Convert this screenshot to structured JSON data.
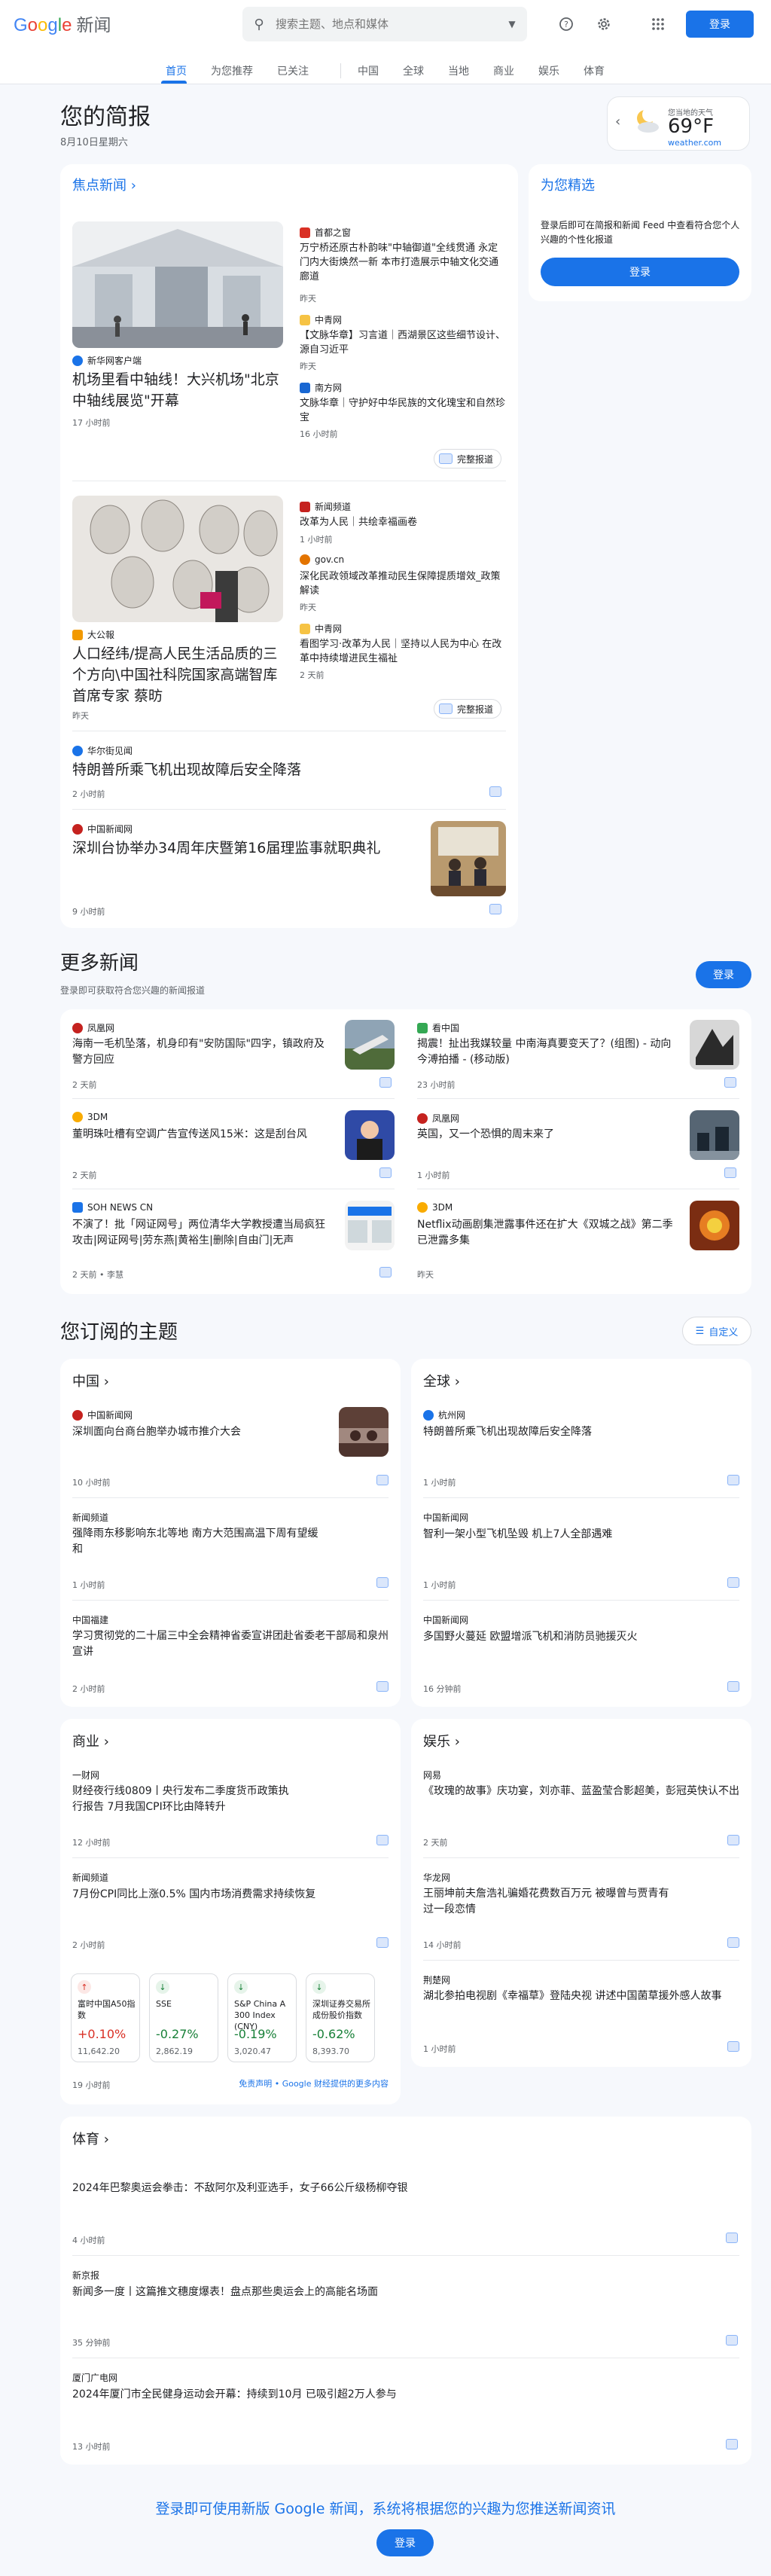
{
  "header": {
    "logo_google": "Google",
    "logo_news": "新闻",
    "search_placeholder": "搜索主题、地点和媒体",
    "login": "登录"
  },
  "nav": {
    "tabs": [
      "首页",
      "为您推荐",
      "已关注",
      "中国",
      "全球",
      "当地",
      "商业",
      "娱乐",
      "体育"
    ],
    "active": "首页"
  },
  "briefing": {
    "title": "您的简报",
    "date": "8月10日星期六"
  },
  "weather": {
    "label": "您当地的天气",
    "temp": "69°F",
    "source": "weather.com"
  },
  "picks": {
    "title": "为您精选",
    "desc": "登录后即可在简报和新闻 Feed 中查看符合您个人兴趣的个性化报道",
    "login": "登录"
  },
  "top": {
    "title": "焦点新闻",
    "full_coverage": "完整报道",
    "c1": {
      "main": {
        "source": "新华网客户端",
        "headline": "机场里看中轴线！大兴机场\"北京中轴线展览\"开幕",
        "time": "17 小时前"
      },
      "side": [
        {
          "source": "首都之窗",
          "headline": "万宁桥还原古朴韵味\"中轴御道\"全线贯通 永定门内大街焕然一新 本市打造展示中轴文化交通廊道",
          "time": "昨天"
        },
        {
          "source": "中青网",
          "headline": "【文脉华章】习言道｜西湖景区这些细节设计、源自习近平",
          "time": "昨天"
        },
        {
          "source": "南方网",
          "headline": "文脉华章｜守护好中华民族的文化瑰宝和自然珍宝",
          "time": "16 小时前"
        }
      ]
    },
    "c2": {
      "main": {
        "source": "大公報",
        "headline": "人口经纬/提高人民生活品质的三个方向\\中国社科院国家高端智库首席专家 蔡昉",
        "time": "昨天"
      },
      "side": [
        {
          "source": "新闻频道",
          "headline": "改革为人民｜共绘幸福画卷",
          "time": "1 小时前"
        },
        {
          "source": "gov.cn",
          "headline": "深化民政领域改革推动民生保障提质增效_政策解读",
          "time": "昨天"
        },
        {
          "source": "中青网",
          "headline": "看图学习·改革为人民｜坚持以人民为中心 在改革中持续增进民生福祉",
          "time": "2 天前"
        }
      ]
    },
    "single1": {
      "source": "华尔街见闻",
      "headline": "特朗普所乘飞机出现故障后安全降落",
      "time": "2 小时前"
    },
    "single2": {
      "source": "中国新闻网",
      "headline": "深圳台协举办34周年庆暨第16届理监事就职典礼",
      "time": "9 小时前"
    }
  },
  "more": {
    "title": "更多新闻",
    "subtitle": "登录即可获取符合您兴趣的新闻报道",
    "login": "登录",
    "items": [
      {
        "source": "凤凰网",
        "headline": "海南一毛机坠落，机身印有\"安防国际\"四字，镇政府及警方回应",
        "time": "2 天前"
      },
      {
        "source": "看中国",
        "headline": "揭震！扯出我媒较量 中南海真要变天了？(组图) - 动向 今溥拍播 - (移动版)",
        "time": "23 小时前"
      },
      {
        "source": "3DM",
        "headline": "董明珠吐槽有空调广告宣传送风15米：这是刮台风",
        "time": "2 天前"
      },
      {
        "source": "凤凰网",
        "headline": "英国，又一个恐惧的周末来了",
        "time": "1 小时前"
      },
      {
        "source": "SOH NEWS CN",
        "headline": "不演了！批「网证网号」两位清华大学教授遭当局疯狂攻击|网证网号|劳东燕|黄裕生|删除|自由门|无声",
        "time": "2 天前 • 李慧"
      },
      {
        "source": "3DM",
        "headline": "Netflix动画剧集泄露事件还在扩大《双城之战》第二季已泄露多集",
        "time": "昨天"
      }
    ]
  },
  "topics": {
    "title": "您订阅的主题",
    "customize": "自定义",
    "china": {
      "title": "中国",
      "items": [
        {
          "source": "中国新闻网",
          "headline": "深圳面向台商台胞举办城市推介大会",
          "time": "10 小时前"
        },
        {
          "source": "新闻频道",
          "headline": "强降雨东移影响东北等地 南方大范围高温下周有望缓和",
          "time": "1 小时前"
        },
        {
          "source": "中国福建",
          "headline": "学习贯彻党的二十届三中全会精神省委宣讲团赴省委老干部局和泉州宣讲",
          "time": "2 小时前"
        }
      ]
    },
    "world": {
      "title": "全球",
      "items": [
        {
          "source": "杭州网",
          "headline": "特朗普所乘飞机出现故障后安全降落",
          "time": "1 小时前"
        },
        {
          "source": "中国新闻网",
          "headline": "智利一架小型飞机坠毁 机上7人全部遇难",
          "time": "1 小时前"
        },
        {
          "source": "中国新闻网",
          "headline": "多国野火蔓延 欧盟增派飞机和消防员驰援灭火",
          "time": "16 分钟前"
        }
      ]
    },
    "business": {
      "title": "商业",
      "items": [
        {
          "source": "一财网",
          "headline": "财经夜行线0809丨央行发布二季度货币政策执行报告 7月我国CPI环比由降转升",
          "time": "12 小时前"
        },
        {
          "source": "新闻频道",
          "headline": "7月份CPI同比上涨0.5% 国内市场消费需求持续恢复",
          "time": "2 小时前"
        }
      ],
      "stocks": [
        {
          "name": "富时中国A50指数",
          "change": "+0.10%",
          "price": "11,642.20",
          "up": true
        },
        {
          "name": "SSE",
          "change": "-0.27%",
          "price": "2,862.19",
          "up": false
        },
        {
          "name": "S&P China A 300 Index (CNY)",
          "change": "-0.19%",
          "price": "3,020.47",
          "up": false
        },
        {
          "name": "深圳证券交易所成份股价指数",
          "change": "-0.62%",
          "price": "8,393.70",
          "up": false
        }
      ],
      "stocks_time": "19 小时前",
      "disclaimer": "免责声明 • Google 财经提供的更多内容"
    },
    "ent": {
      "title": "娱乐",
      "items": [
        {
          "source": "网易",
          "headline": "《玫瑰的故事》庆功宴，刘亦菲、蓝盈莹合影超美，彭冠英快认不出",
          "time": "2 天前"
        },
        {
          "source": "华龙网",
          "headline": "王丽坤前夫詹浩礼骗婚花费数百万元 被曝曾与贾青有过一段恋情",
          "time": "14 小时前"
        },
        {
          "source": "荆楚网",
          "headline": "湖北参拍电视剧《幸福草》登陆央视 讲述中国菌草援外感人故事",
          "time": "1 小时前"
        }
      ]
    },
    "sports": {
      "title": "体育",
      "items": [
        {
          "source": "",
          "headline": "2024年巴黎奥运会拳击：不敌阿尔及利亚选手，女子66公斤级杨柳夺银",
          "time": "4 小时前"
        },
        {
          "source": "新京报",
          "headline": "新闻多一度丨这篇推文穗度爆表！盘点那些奥运会上的高能名场面",
          "time": "35 分钟前"
        },
        {
          "source": "厦门广电网",
          "headline": "2024年厦门市全民健身运动会开幕：持续到10月 已吸引超2万人参与",
          "time": "13 小时前"
        }
      ]
    }
  },
  "footer": {
    "text": "登录即可使用新版 Google 新闻，系统将根据您的兴趣为您推送新闻资讯",
    "login": "登录"
  }
}
